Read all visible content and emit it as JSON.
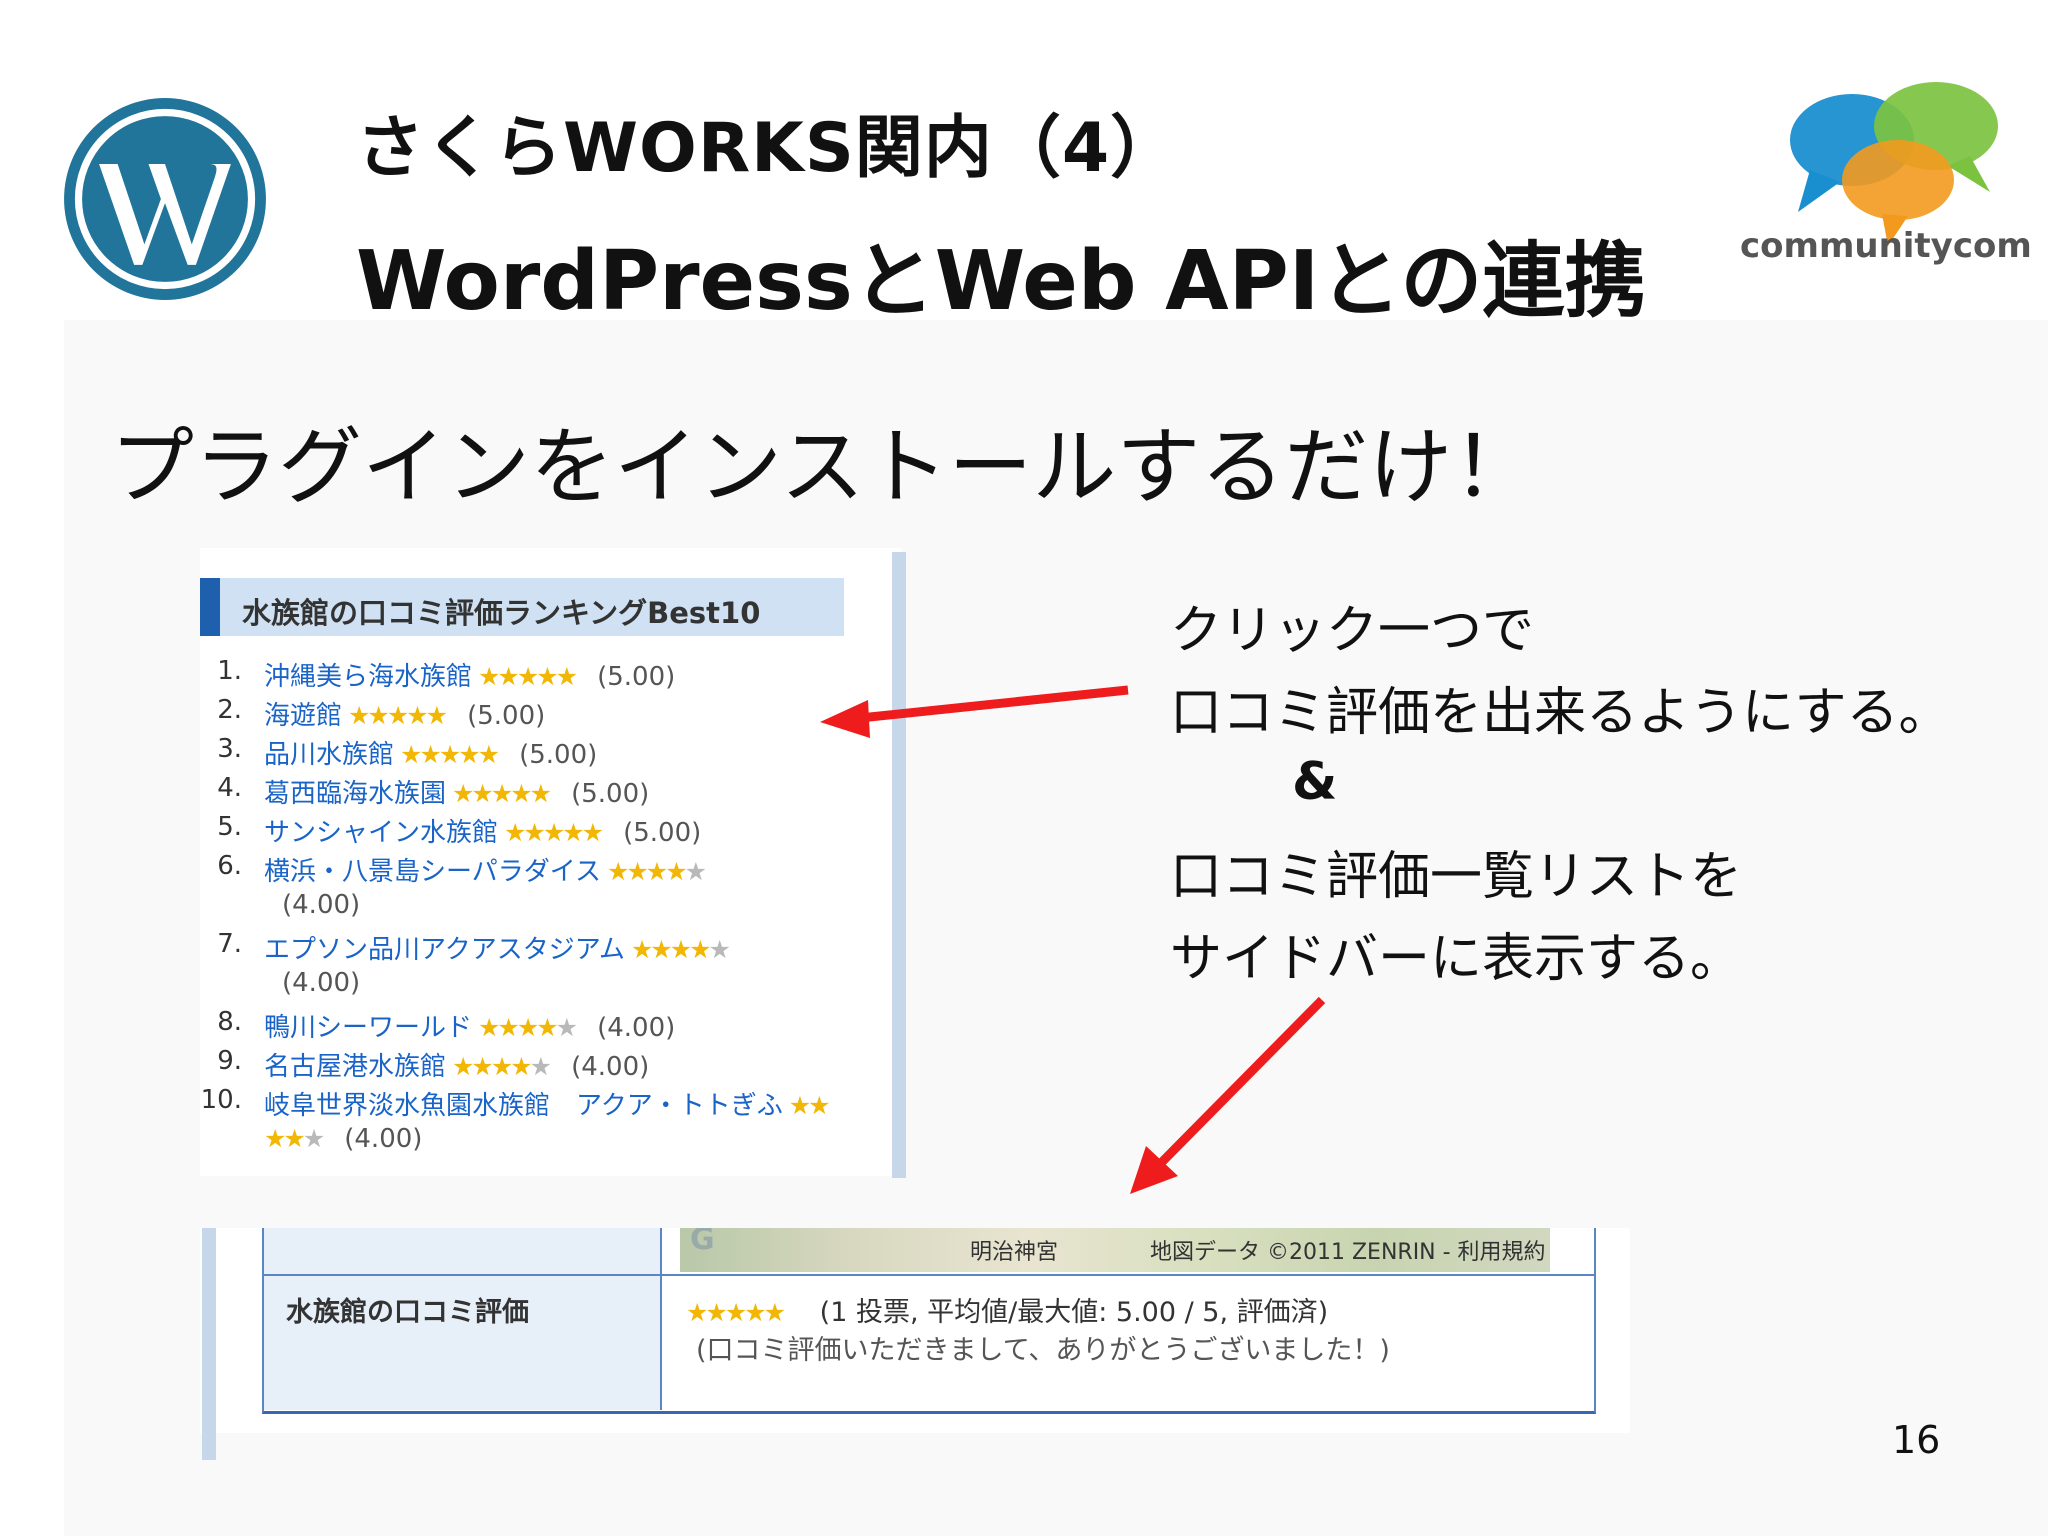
{
  "header": {
    "title_line1": "さくらWORKS関内（4）",
    "title_line2": "WordPressとWeb APIとの連携",
    "logo_text": "communitycom"
  },
  "subtitle": "プラグインをインストールするだけ！",
  "widget": {
    "heading": "水族館の口コミ評価ランキングBest10",
    "items": [
      {
        "rank": "1.",
        "name": "沖縄美ら海水族館",
        "stars": 5,
        "score": "(5.00)"
      },
      {
        "rank": "2.",
        "name": "海遊館",
        "stars": 5,
        "score": "(5.00)"
      },
      {
        "rank": "3.",
        "name": "品川水族館",
        "stars": 5,
        "score": "(5.00)"
      },
      {
        "rank": "4.",
        "name": "葛西臨海水族園",
        "stars": 5,
        "score": "(5.00)"
      },
      {
        "rank": "5.",
        "name": "サンシャイン水族館",
        "stars": 5,
        "score": "(5.00)"
      },
      {
        "rank": "6.",
        "name": "横浜・八景島シーパラダイス",
        "stars": 4,
        "score": "(4.00)"
      },
      {
        "rank": "7.",
        "name": "エプソン品川アクアスタジアム",
        "stars": 4,
        "score": "(4.00)"
      },
      {
        "rank": "8.",
        "name": "鴨川シーワールド",
        "stars": 4,
        "score": "(4.00)"
      },
      {
        "rank": "9.",
        "name": "名古屋港水族館",
        "stars": 4,
        "score": "(4.00)"
      },
      {
        "rank": "10.",
        "name": "岐阜世界淡水魚園水族館　アクア・トトぎふ",
        "stars": 4,
        "score": "(4.00)"
      }
    ]
  },
  "notes": {
    "line1": "クリック一つで",
    "line2": "口コミ評価を出来るようにする。",
    "line3": "&",
    "line4": "口コミ評価一覧リストを",
    "line5": "サイドバーに表示する。"
  },
  "bottom": {
    "map_label": "明治神宮",
    "map_copyright": "地図データ ©2011 ZENRIN - 利用規約",
    "row_label": "水族館の口コミ評価",
    "rating_stars": 5,
    "rating_text": "(1 投票, 平均値/最大値: 5.00 / 5, 評価済)",
    "thanks_text": "(口コミ評価いただきまして、ありがとうございました！)"
  },
  "page_number": "16",
  "colors": {
    "wp_blue": "#21759b",
    "link_blue": "#1a64c8",
    "star_gold": "#f2b705",
    "arrow_red": "#ee1c1c",
    "widget_head_bg": "#cfe1f2"
  }
}
